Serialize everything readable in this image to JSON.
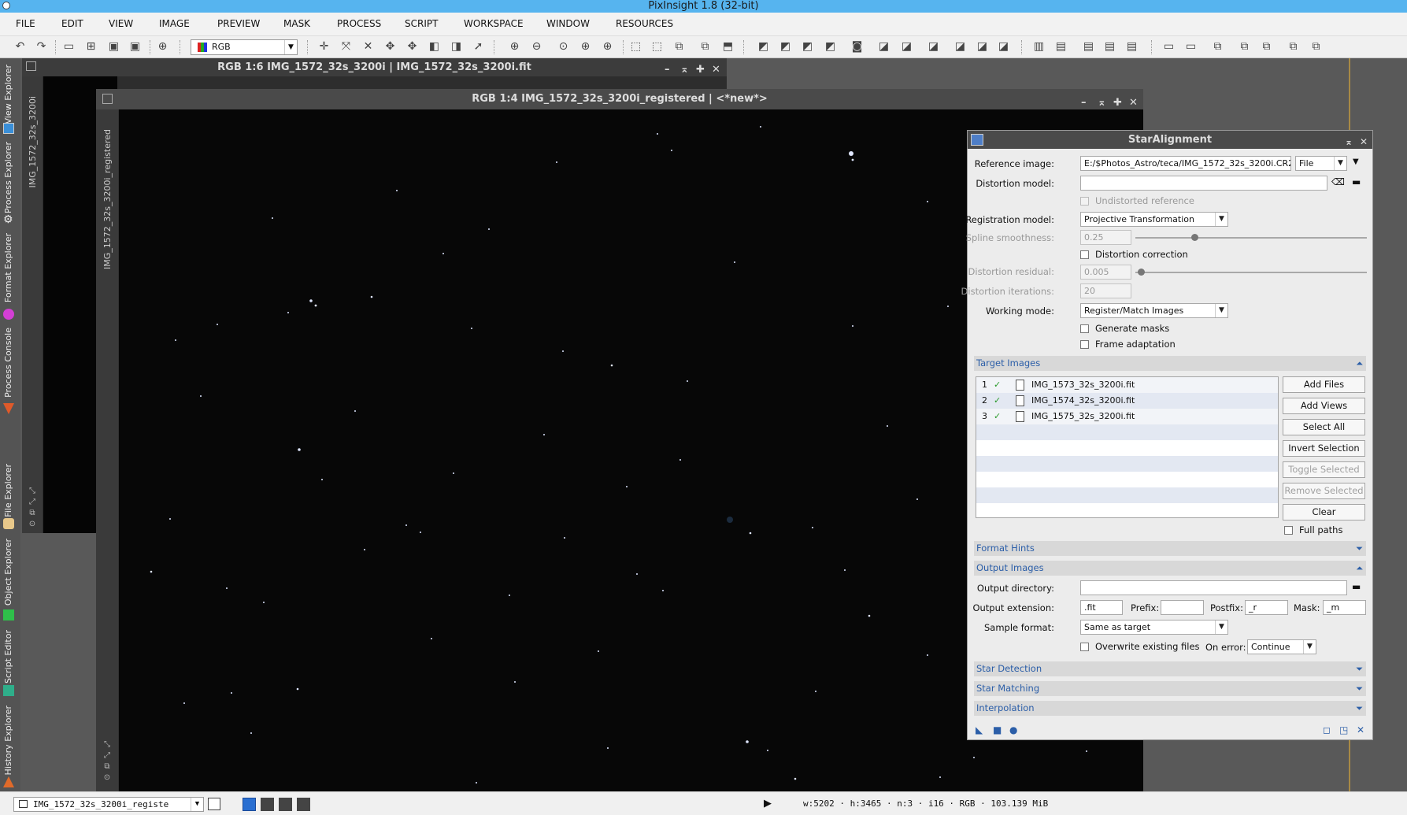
{
  "app_title": "PixInsight 1.8 (32-bit)",
  "menu": [
    "FILE",
    "EDIT",
    "VIEW",
    "IMAGE",
    "PREVIEW",
    "MASK",
    "PROCESS",
    "SCRIPT",
    "WORKSPACE",
    "WINDOW",
    "RESOURCES"
  ],
  "toolbar": {
    "channel_select": "RGB"
  },
  "left_tabs": [
    "View Explorer",
    "Process Explorer",
    "Format Explorer",
    "Process Console",
    "File Explorer",
    "Object Explorer",
    "Script Editor",
    "History Explorer"
  ],
  "window1": {
    "title": "RGB 1:6 IMG_1572_32s_3200i | IMG_1572_32s_3200i.fit",
    "side_label": "IMG_1572_32s_3200i"
  },
  "window2": {
    "title": "RGB 1:4 IMG_1572_32s_3200i_registered | <*new*>",
    "side_label": "IMG_1572_32s_3200i_registered"
  },
  "dialog": {
    "title": "StarAlignment",
    "reference_image_label": "Reference image:",
    "reference_image_value": "E:/$Photos_Astro/teca/IMG_1572_32s_3200i.CR2",
    "reference_source": "File",
    "distortion_model_label": "Distortion model:",
    "distortion_model_value": "",
    "undistorted_reference": "Undistorted reference",
    "registration_model_label": "Registration model:",
    "registration_model_value": "Projective Transformation",
    "spline_smoothness_label": "Spline smoothness:",
    "spline_smoothness_value": "0.25",
    "distortion_correction": "Distortion correction",
    "distortion_residual_label": "Distortion residual:",
    "distortion_residual_value": "0.005",
    "distortion_iterations_label": "Distortion iterations:",
    "distortion_iterations_value": "20",
    "working_mode_label": "Working mode:",
    "working_mode_value": "Register/Match Images",
    "generate_masks": "Generate masks",
    "frame_adaptation": "Frame adaptation",
    "target_images_section": "Target Images",
    "target_images": [
      {
        "index": "1",
        "name": "IMG_1573_32s_3200i.fit"
      },
      {
        "index": "2",
        "name": "IMG_1574_32s_3200i.fit"
      },
      {
        "index": "3",
        "name": "IMG_1575_32s_3200i.fit"
      }
    ],
    "buttons": {
      "add_files": "Add Files",
      "add_views": "Add Views",
      "select_all": "Select All",
      "invert_selection": "Invert Selection",
      "toggle_selected": "Toggle Selected",
      "remove_selected": "Remove Selected",
      "clear": "Clear"
    },
    "full_paths": "Full paths",
    "format_hints_section": "Format Hints",
    "output_images_section": "Output Images",
    "output_directory_label": "Output directory:",
    "output_directory_value": "",
    "output_extension_label": "Output extension:",
    "output_extension_value": ".fit",
    "prefix_label": "Prefix:",
    "prefix_value": "",
    "postfix_label": "Postfix:",
    "postfix_value": "_r",
    "mask_label": "Mask:",
    "mask_value": "_m",
    "sample_format_label": "Sample format:",
    "sample_format_value": "Same as target",
    "overwrite_existing": "Overwrite existing files",
    "on_error_label": "On error:",
    "on_error_value": "Continue",
    "star_detection_section": "Star Detection",
    "star_matching_section": "Star Matching",
    "interpolation_section": "Interpolation"
  },
  "statusbar": {
    "view_select": "IMG_1572_32s_3200i_registe",
    "image_info": "w:5202 · h:3465 · n:3 · i16 · RGB · 103.139 MiB"
  }
}
